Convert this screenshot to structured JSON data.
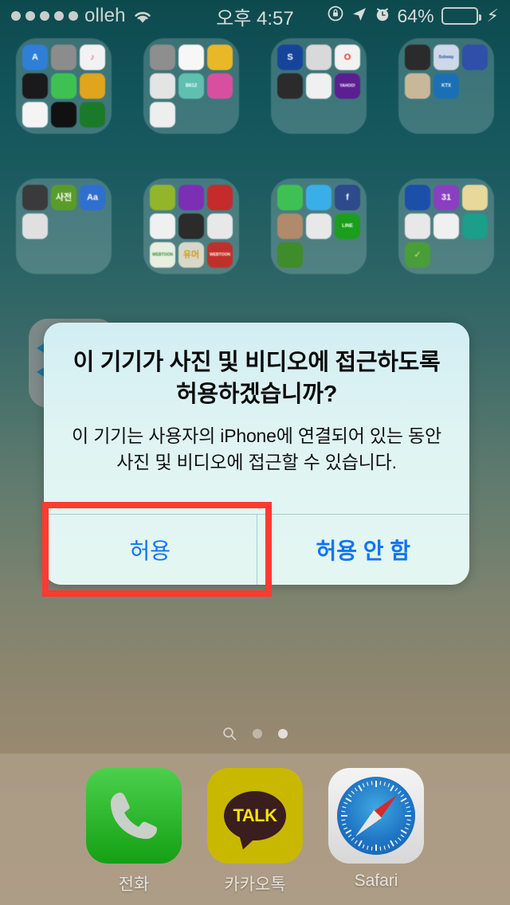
{
  "status_bar": {
    "carrier": "olleh",
    "signal_dots": 5,
    "wifi_icon": "wifi-icon",
    "time": "오후 4:57",
    "rotation_lock_icon": "rotation-lock-icon",
    "location_icon": "location-arrow-icon",
    "alarm_icon": "alarm-clock-icon",
    "battery_percent": "64%",
    "battery_level": 64,
    "battery_color": "#3ec53e",
    "charging_icon": "lightning-bolt-icon"
  },
  "home_screen": {
    "folders": [
      {
        "name": "folder-utilities",
        "apps": [
          {
            "label": "A",
            "bg": "#2f7ed8",
            "fg": "#ffffff",
            "shape": "appstore"
          },
          {
            "label": "",
            "bg": "#8c8c8c",
            "fg": "#ffffff",
            "shape": "settings"
          },
          {
            "label": "♪",
            "bg": "#f2f2f2",
            "fg": "#e8467c",
            "shape": "music"
          },
          {
            "label": "",
            "bg": "#1a1a1a",
            "fg": "#ffffff",
            "shape": "wallet"
          },
          {
            "label": "",
            "bg": "#3ec152",
            "fg": "#ffffff",
            "shape": "facetime"
          },
          {
            "label": "",
            "bg": "#e0a51c",
            "fg": "#ffffff",
            "shape": "tips"
          },
          {
            "label": "",
            "bg": "#f4f4f4",
            "fg": "#ffffff",
            "shape": "photos"
          },
          {
            "label": "",
            "bg": "#111111",
            "fg": "#ffffff",
            "shape": "clock"
          },
          {
            "label": "",
            "bg": "#1b7a2a",
            "fg": "#ffffff",
            "shape": "green-disc"
          }
        ]
      },
      {
        "name": "folder-camera",
        "apps": [
          {
            "label": "",
            "bg": "#8e8e8e",
            "fg": "#333333",
            "shape": "camera"
          },
          {
            "label": "",
            "bg": "#f7f7f7",
            "fg": "#ffffff",
            "shape": "photos"
          },
          {
            "label": "",
            "bg": "#e8b829",
            "fg": "#ffffff",
            "shape": "ring-cam"
          },
          {
            "label": "",
            "bg": "#e4e4e4",
            "fg": "#1a6fb5",
            "shape": "retro-cam"
          },
          {
            "label": "B612",
            "bg": "#5fbfb0",
            "fg": "#ffffff",
            "shape": "b612"
          },
          {
            "label": "",
            "bg": "#d94fa0",
            "fg": "#ffff00",
            "shape": "magic-wand"
          },
          {
            "label": "",
            "bg": "#eeeeee",
            "fg": "#36b7d8",
            "shape": "blue-blob"
          },
          {
            "label": "",
            "bg": "transparent",
            "fg": "",
            "shape": "empty"
          },
          {
            "label": "",
            "bg": "transparent",
            "fg": "",
            "shape": "empty"
          }
        ]
      },
      {
        "name": "folder-finance",
        "apps": [
          {
            "label": "S",
            "bg": "#17449b",
            "fg": "#ffffff",
            "shape": "bank"
          },
          {
            "label": "",
            "bg": "#d9d9d9",
            "fg": "#c0392b",
            "shape": "house"
          },
          {
            "label": "O",
            "bg": "#f2f2f2",
            "fg": "#d6301f",
            "shape": "o-app"
          },
          {
            "label": "",
            "bg": "#2b2b2b",
            "fg": "#ffffff",
            "shape": "keypad"
          },
          {
            "label": "",
            "bg": "#f0f0f0",
            "fg": "#9b59b6",
            "shape": "stripes"
          },
          {
            "label": "YAHOO!",
            "bg": "#5c1f91",
            "fg": "#ffffff",
            "shape": "yahoo-weather"
          },
          {
            "label": "",
            "bg": "transparent",
            "fg": "",
            "shape": "empty"
          },
          {
            "label": "",
            "bg": "transparent",
            "fg": "",
            "shape": "empty"
          },
          {
            "label": "",
            "bg": "transparent",
            "fg": "",
            "shape": "empty"
          }
        ]
      },
      {
        "name": "folder-transit",
        "apps": [
          {
            "label": "",
            "bg": "#2b2b2b",
            "fg": "#e8b12a",
            "shape": "subway-map"
          },
          {
            "label": "Subway",
            "bg": "#cfd8e8",
            "fg": "#1b4f9c",
            "shape": "subway"
          },
          {
            "label": "",
            "bg": "#2f4fa8",
            "fg": "#3ec152",
            "shape": "map-pin"
          },
          {
            "label": "",
            "bg": "#c8b89a",
            "fg": "#86b5d8",
            "shape": "train"
          },
          {
            "label": "KTX",
            "bg": "#1b6fb5",
            "fg": "#ffffff",
            "shape": "ktx"
          },
          {
            "label": "",
            "bg": "transparent",
            "fg": "",
            "shape": "empty"
          },
          {
            "label": "",
            "bg": "transparent",
            "fg": "",
            "shape": "empty"
          },
          {
            "label": "",
            "bg": "transparent",
            "fg": "",
            "shape": "empty"
          },
          {
            "label": "",
            "bg": "transparent",
            "fg": "",
            "shape": "empty"
          }
        ]
      },
      {
        "name": "folder-audio",
        "apps": [
          {
            "label": "",
            "bg": "#3a3a3a",
            "fg": "#ffffff",
            "shape": "speaker"
          },
          {
            "label": "사전",
            "bg": "#5a9c2a",
            "fg": "#ffffff",
            "shape": "dictionary"
          },
          {
            "label": "Aa",
            "bg": "#2f6fd0",
            "fg": "#ffffff",
            "shape": "translate"
          },
          {
            "label": "",
            "bg": "#e0e0e0",
            "fg": "#333333",
            "shape": "voice-memo"
          },
          {
            "label": "",
            "bg": "transparent",
            "fg": "",
            "shape": "empty"
          },
          {
            "label": "",
            "bg": "transparent",
            "fg": "",
            "shape": "empty"
          },
          {
            "label": "",
            "bg": "transparent",
            "fg": "",
            "shape": "empty"
          },
          {
            "label": "",
            "bg": "transparent",
            "fg": "",
            "shape": "empty"
          },
          {
            "label": "",
            "bg": "transparent",
            "fg": "",
            "shape": "empty"
          }
        ]
      },
      {
        "name": "folder-entertainment",
        "apps": [
          {
            "label": "",
            "bg": "#93b52a",
            "fg": "#ffffff",
            "shape": "mars"
          },
          {
            "label": "",
            "bg": "#7b2fb5",
            "fg": "#ffffff",
            "shape": "player"
          },
          {
            "label": "",
            "bg": "#c42b2b",
            "fg": "#f0d040",
            "shape": "red-cn"
          },
          {
            "label": "",
            "bg": "#f0f0f0",
            "fg": "#3a7fd5",
            "shape": "play"
          },
          {
            "label": "",
            "bg": "#2b2b2b",
            "fg": "#9b59b6",
            "shape": "eyes"
          },
          {
            "label": "",
            "bg": "#e8e8e8",
            "fg": "#d6201f",
            "shape": "youtube"
          },
          {
            "label": "WEBTOON",
            "bg": "#e8eee0",
            "fg": "#2e8b2e",
            "shape": "webtoon-green"
          },
          {
            "label": "유머",
            "bg": "#d8d8c8",
            "fg": "#c8a01a",
            "shape": "humor"
          },
          {
            "label": "WEBTOON",
            "bg": "#c0302a",
            "fg": "#ffffff",
            "shape": "webtoon-red"
          }
        ]
      },
      {
        "name": "folder-social",
        "apps": [
          {
            "label": "",
            "bg": "#3ec152",
            "fg": "#ffffff",
            "shape": "messages"
          },
          {
            "label": "",
            "bg": "#3aaee8",
            "fg": "#ffffff",
            "shape": "mail"
          },
          {
            "label": "f",
            "bg": "#2d4a8a",
            "fg": "#ffffff",
            "shape": "facebook"
          },
          {
            "label": "",
            "bg": "#b08a6a",
            "fg": "#ffffff",
            "shape": "instagram"
          },
          {
            "label": "",
            "bg": "#e8e8e8",
            "fg": "#1e8fe8",
            "shape": "messenger"
          },
          {
            "label": "LINE",
            "bg": "#1b9e1b",
            "fg": "#ffffff",
            "shape": "line"
          },
          {
            "label": "",
            "bg": "#3e8c2a",
            "fg": "#6b3a1a",
            "shape": "green-app"
          },
          {
            "label": "",
            "bg": "transparent",
            "fg": "",
            "shape": "empty"
          },
          {
            "label": "",
            "bg": "transparent",
            "fg": "",
            "shape": "empty"
          }
        ]
      },
      {
        "name": "folder-productivity",
        "apps": [
          {
            "label": "",
            "bg": "#1b4fa8",
            "fg": "#ffffff",
            "shape": "cloud"
          },
          {
            "label": "31",
            "bg": "#8a3fc0",
            "fg": "#ffffff",
            "shape": "calendar"
          },
          {
            "label": "",
            "bg": "#e8d89a",
            "fg": "#2e8b2e",
            "shape": "notes"
          },
          {
            "label": "",
            "bg": "#e8e8e8",
            "fg": "#d63a2a",
            "shape": "red-dots"
          },
          {
            "label": "",
            "bg": "#f0f0f0",
            "fg": "#e8b12a",
            "shape": "ads"
          },
          {
            "label": "",
            "bg": "#1b9e8a",
            "fg": "#ffffff",
            "shape": "contacts"
          },
          {
            "label": "✓",
            "bg": "#4a9e3a",
            "fg": "#c8e8a0",
            "shape": "check"
          },
          {
            "label": "",
            "bg": "transparent",
            "fg": "",
            "shape": "empty"
          },
          {
            "label": "",
            "bg": "transparent",
            "fg": "",
            "shape": "empty"
          }
        ]
      }
    ],
    "page_indicator": {
      "search_icon": "search-icon",
      "dots": 2,
      "active_index": 1
    }
  },
  "dock": {
    "apps": [
      {
        "label": "전화",
        "icon": "phone-icon"
      },
      {
        "label": "카카오톡",
        "icon": "kakaotalk-icon",
        "badge_text": "TALK"
      },
      {
        "label": "Safari",
        "icon": "safari-compass-icon"
      }
    ]
  },
  "alert": {
    "title": "이 기기가 사진 및 비디오에 접근하도록 허용하겠습니까?",
    "message": "이 기기는 사용자의 iPhone에 연결되어 있는 동안 사진 및 비디오에 접근할 수 있습니다.",
    "buttons": [
      {
        "label": "허용",
        "style": "default"
      },
      {
        "label": "허용 안 함",
        "style": "bold"
      }
    ],
    "button_color": "#0b76f5"
  },
  "annotation": {
    "highlight_color": "#fc3b30",
    "highlight_target": "허용"
  }
}
